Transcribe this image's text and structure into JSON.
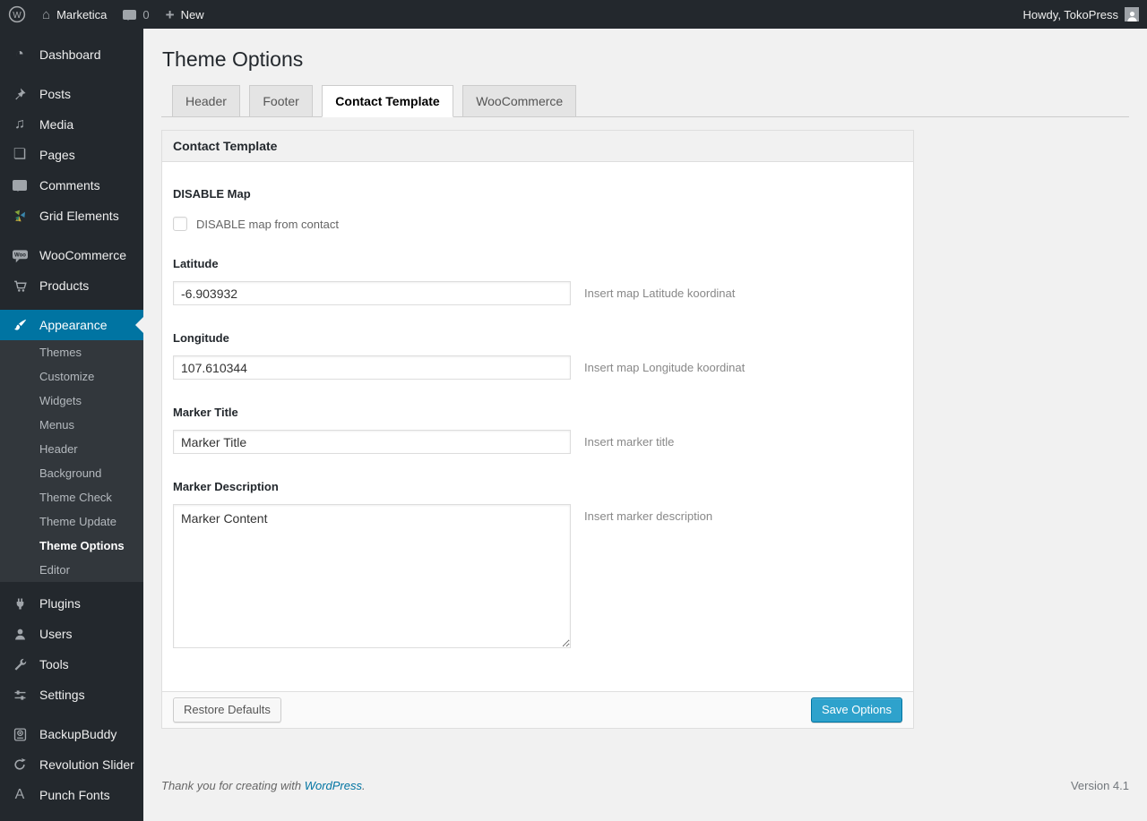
{
  "admin_bar": {
    "site_name": "Marketica",
    "comments_count": "0",
    "new_label": "New",
    "howdy": "Howdy, TokoPress"
  },
  "icons": {
    "wp_letter": "W",
    "home_glyph": "⌂",
    "new_plus": "+",
    "dashboard_glyph": "◔",
    "media_glyph": "♫",
    "pages_glyph": "❏",
    "woo_text": "Woo",
    "punch_letter": "A"
  },
  "sidebar": {
    "items": [
      {
        "label": "Dashboard"
      },
      {
        "label": "Posts"
      },
      {
        "label": "Media"
      },
      {
        "label": "Pages"
      },
      {
        "label": "Comments"
      },
      {
        "label": "Grid Elements"
      },
      {
        "label": "WooCommerce"
      },
      {
        "label": "Products"
      },
      {
        "label": "Appearance"
      },
      {
        "label": "Plugins"
      },
      {
        "label": "Users"
      },
      {
        "label": "Tools"
      },
      {
        "label": "Settings"
      },
      {
        "label": "BackupBuddy"
      },
      {
        "label": "Revolution Slider"
      },
      {
        "label": "Punch Fonts"
      }
    ],
    "appearance_submenu": [
      "Themes",
      "Customize",
      "Widgets",
      "Menus",
      "Header",
      "Background",
      "Theme Check",
      "Theme Update",
      "Theme Options",
      "Editor"
    ]
  },
  "main": {
    "page_title": "Theme Options",
    "tabs": [
      {
        "label": "Header"
      },
      {
        "label": "Footer"
      },
      {
        "label": "Contact Template"
      },
      {
        "label": "WooCommerce"
      }
    ],
    "panel": {
      "title": "Contact Template",
      "fields": {
        "disable_map": {
          "label": "DISABLE Map",
          "checkbox_label": "DISABLE map from contact",
          "checked": false
        },
        "latitude": {
          "label": "Latitude",
          "value": "-6.903932",
          "help": "Insert map Latitude koordinat"
        },
        "longitude": {
          "label": "Longitude",
          "value": "107.610344",
          "help": "Insert map Longitude koordinat"
        },
        "marker_title": {
          "label": "Marker Title",
          "value": "Marker Title",
          "help": "Insert marker title"
        },
        "marker_description": {
          "label": "Marker Description",
          "value": "Marker Content",
          "help": "Insert marker description"
        }
      },
      "footer": {
        "restore_label": "Restore Defaults",
        "save_label": "Save Options"
      }
    }
  },
  "footer": {
    "thanks_prefix": "Thank you for creating with ",
    "wordpress_link": "WordPress",
    "thanks_suffix": ".",
    "version": "Version 4.1"
  },
  "colors": {
    "admin_bar_bg": "#23282d",
    "sidebar_bg": "#23282d",
    "submenu_bg": "#32373c",
    "menu_active_bg": "#0074a2",
    "content_bg": "#f1f1f1",
    "primary_button_bg": "#2ea2cc",
    "link": "#0074a2"
  }
}
